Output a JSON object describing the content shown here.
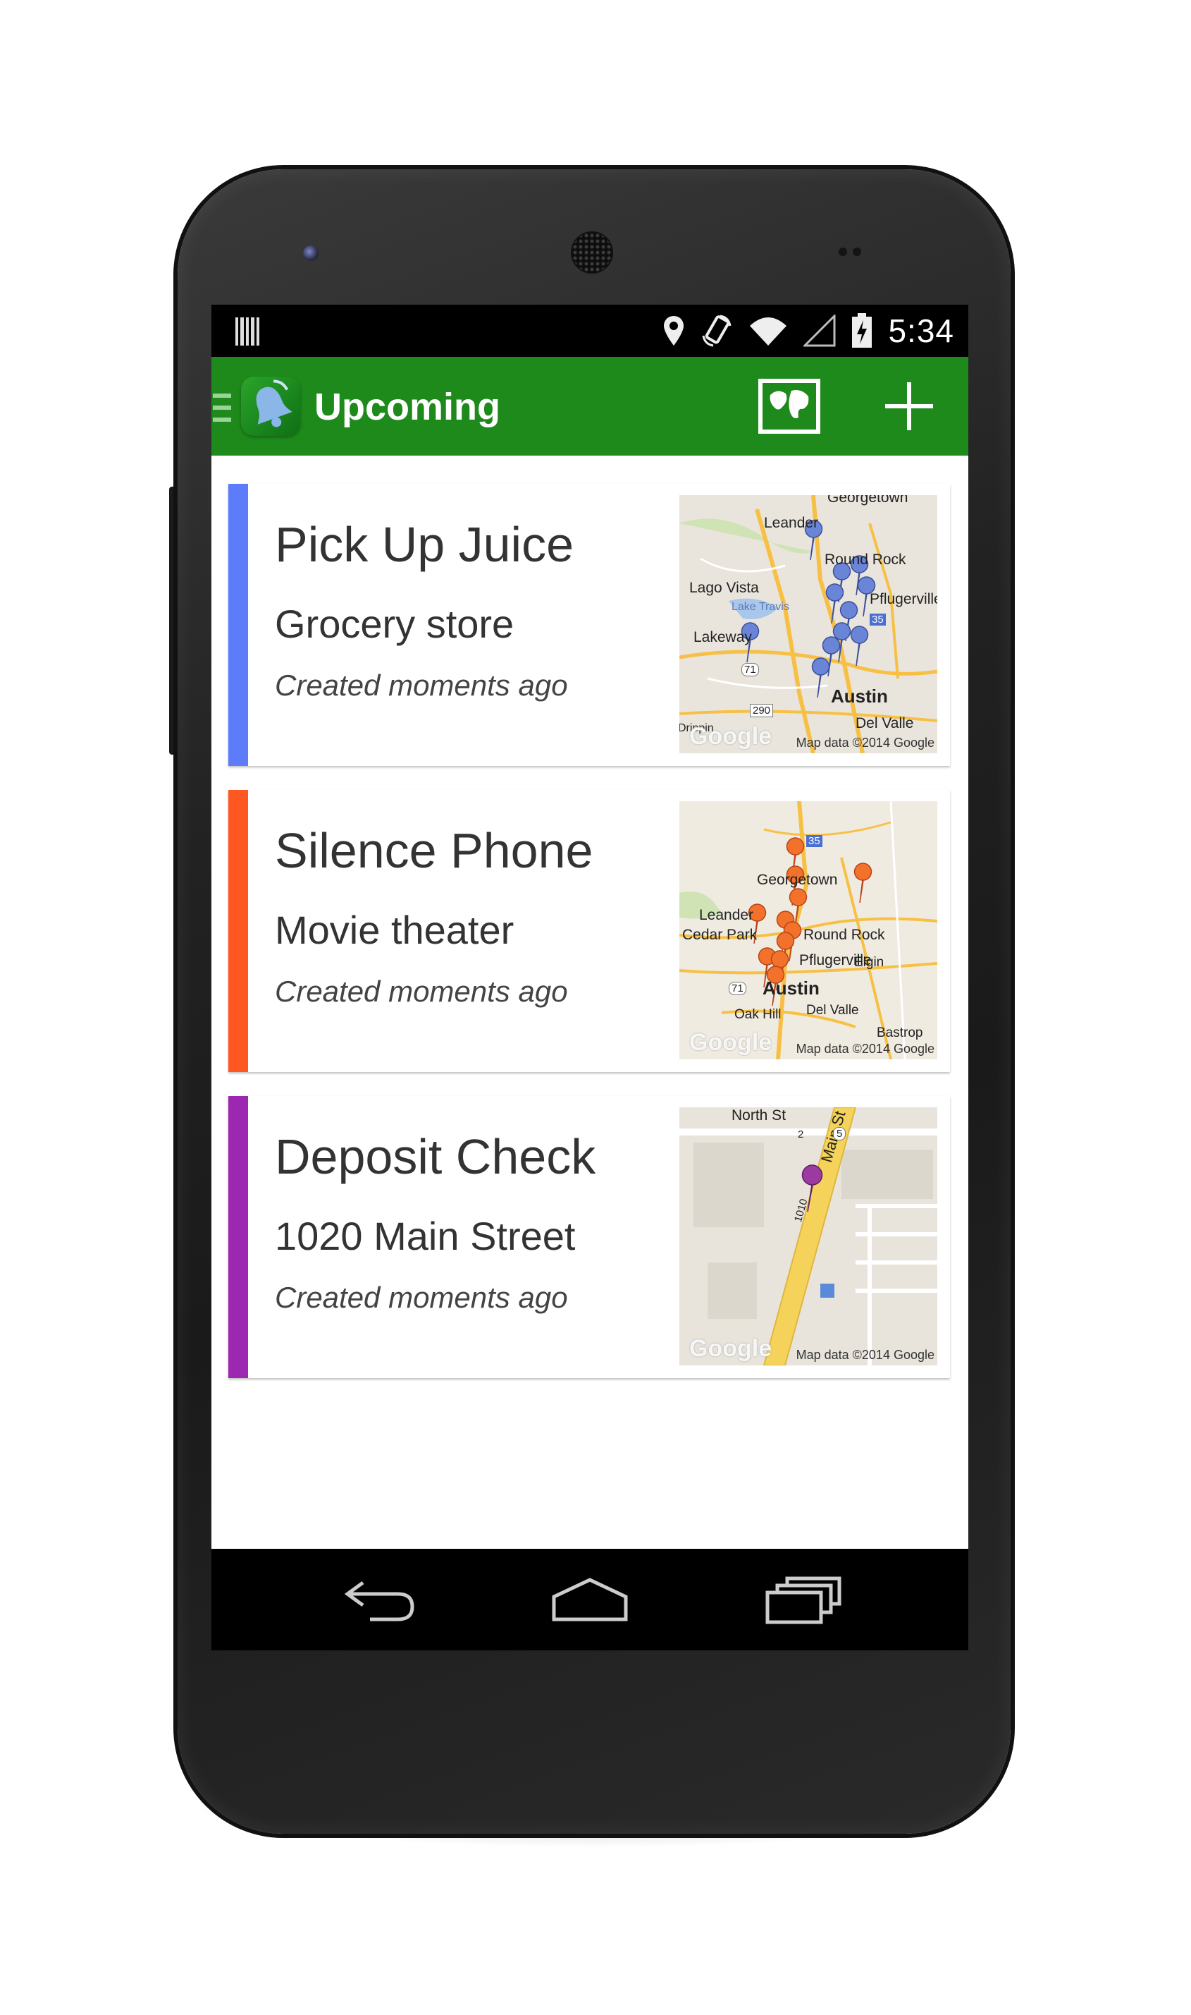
{
  "status_bar": {
    "time": "5:34",
    "icons": [
      "notification-icon",
      "location-icon",
      "rotate-icon",
      "wifi-icon",
      "signal-icon",
      "battery-charging-icon"
    ]
  },
  "app_bar": {
    "title": "Upcoming",
    "accent_color": "#1d8a1b",
    "actions": [
      "map-view-icon",
      "add-icon"
    ]
  },
  "reminders": [
    {
      "title": "Pick Up Juice",
      "subtitle": "Grocery store",
      "meta": "Created moments ago",
      "color": "#5c7cfa",
      "map": {
        "credit": "Map data ©2014 Google",
        "logo": "Google",
        "labels": [
          "Georgetown",
          "Leander",
          "Round Rock",
          "Lago Vista",
          "Lake Travis",
          "Pflugerville",
          "Lakeway",
          "Austin",
          "Del Valle",
          "Dripping Springs",
          "35",
          "71",
          "290"
        ]
      }
    },
    {
      "title": "Silence Phone",
      "subtitle": "Movie theater",
      "meta": "Created moments ago",
      "color": "#ff5722",
      "map": {
        "credit": "Map data ©2014 Google",
        "logo": "Google",
        "labels": [
          "35",
          "Georgetown",
          "Leander",
          "Cedar Park",
          "Round Rock",
          "Pflugerville",
          "Elgin",
          "71",
          "Austin",
          "Oak Hill",
          "Del Valle",
          "Bastrop"
        ]
      }
    },
    {
      "title": "Deposit Check",
      "subtitle": "1020 Main Street",
      "meta": "Created moments ago",
      "color": "#9c27b0",
      "map": {
        "credit": "Map data ©2014 Google",
        "logo": "Google",
        "labels": [
          "North St",
          "Main St",
          "5",
          "2",
          "1010"
        ]
      }
    }
  ],
  "nav_bar": [
    "back-icon",
    "home-icon",
    "recent-apps-icon"
  ]
}
